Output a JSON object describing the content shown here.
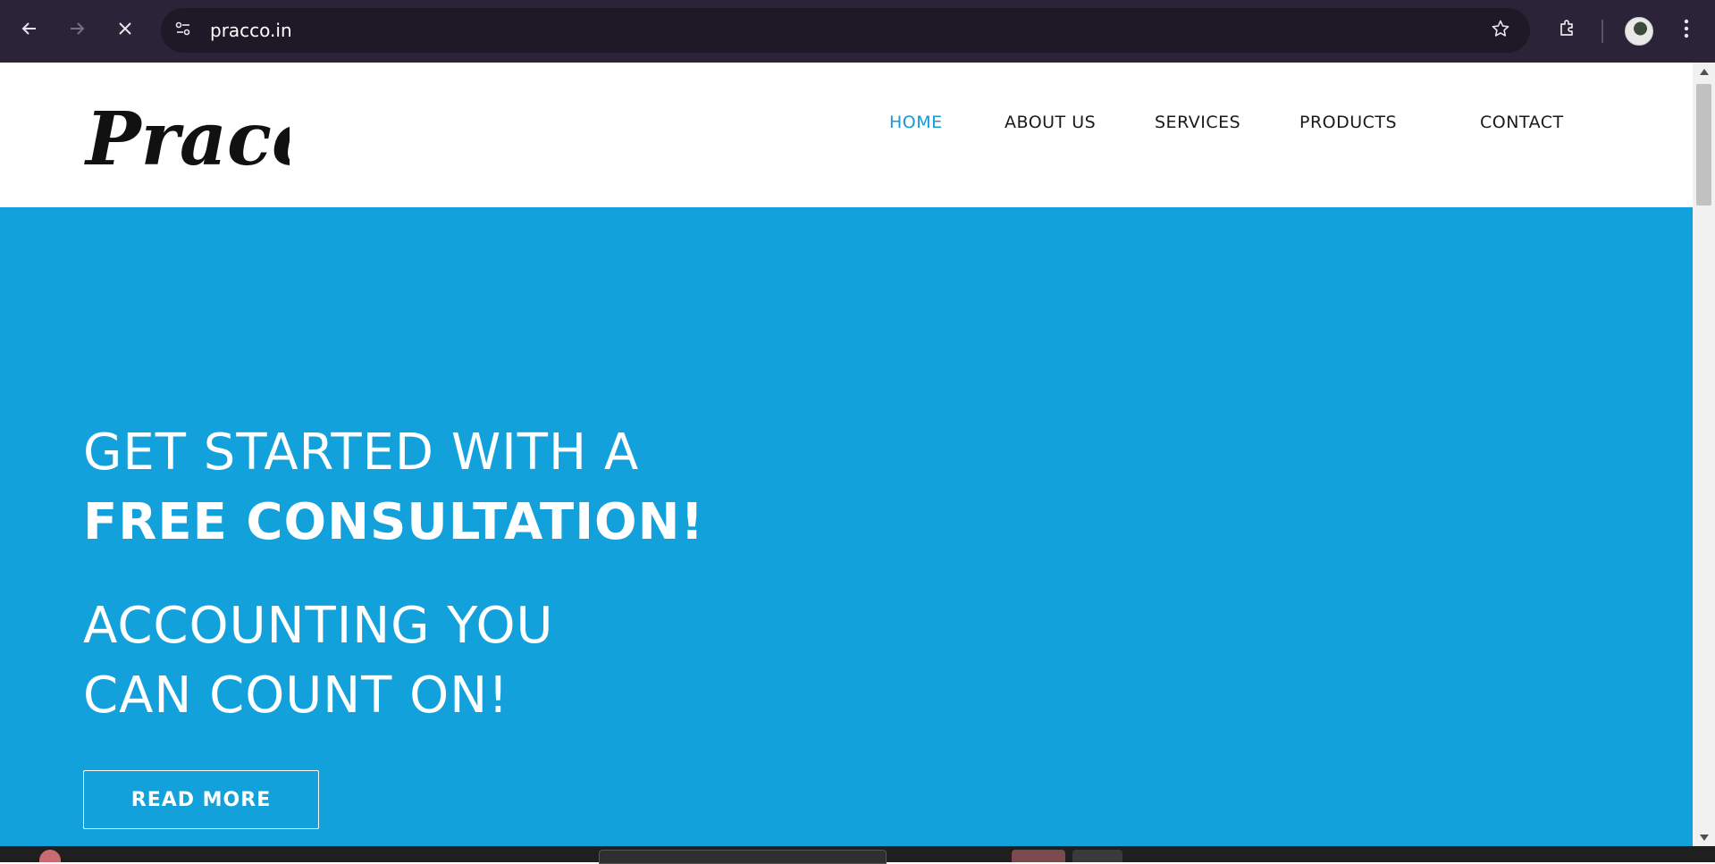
{
  "browser": {
    "url": "pracco.in",
    "icons": {
      "back": "arrow-left-icon",
      "forward": "arrow-right-icon",
      "stop": "close-icon",
      "site_info": "tune-icon",
      "bookmark": "star-icon",
      "extensions": "puzzle-icon",
      "menu": "vertical-dots-icon"
    }
  },
  "site": {
    "logo_text": "Pracco",
    "nav": [
      {
        "label": "HOME",
        "active": true
      },
      {
        "label": "ABOUT US",
        "active": false
      },
      {
        "label": "SERVICES",
        "active": false
      },
      {
        "label": "PRODUCTS",
        "active": false
      },
      {
        "label": "CONTACT",
        "active": false
      }
    ]
  },
  "hero": {
    "line1": "GET STARTED WITH A",
    "line2": "FREE CONSULTATION!",
    "line3": "ACCOUNTING YOU",
    "line4": "CAN COUNT ON!",
    "cta_label": "READ MORE"
  },
  "colors": {
    "accent": "#139bd6",
    "hero_bg": "#13a1db",
    "chrome_bg": "#2b2338",
    "nav_text": "#1a1a1a"
  }
}
